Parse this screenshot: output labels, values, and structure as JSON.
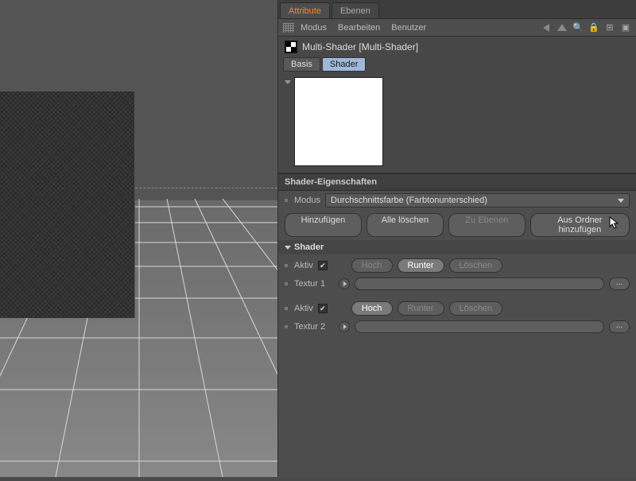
{
  "top_tabs": {
    "attribute": "Attribute",
    "ebenen": "Ebenen"
  },
  "menu": {
    "modus": "Modus",
    "bearbeiten": "Bearbeiten",
    "benutzer": "Benutzer"
  },
  "object": {
    "title": "Multi-Shader [Multi-Shader]"
  },
  "sub_tabs": {
    "basis": "Basis",
    "shader": "Shader"
  },
  "section": {
    "title": "Shader-Eigenschaften"
  },
  "mode_row": {
    "label": "Modus",
    "value": "Durchschnittsfarbe (Farbtonunterschied)"
  },
  "btns": {
    "add": "Hinzufügen",
    "delete_all": "Alle löschen",
    "to_layers": "Zu Ebenen",
    "add_from_folder": "Aus Ordner hinzufügen"
  },
  "shader_collapse": "Shader",
  "shader1": {
    "aktiv_label": "Aktiv",
    "hoch": "Hoch",
    "runter": "Runter",
    "loeschen": "Löschen",
    "tex_label": "Textur 1"
  },
  "shader2": {
    "aktiv_label": "Aktiv",
    "hoch": "Hoch",
    "runter": "Runter",
    "loeschen": "Löschen",
    "tex_label": "Textur 2"
  },
  "dots": "..."
}
